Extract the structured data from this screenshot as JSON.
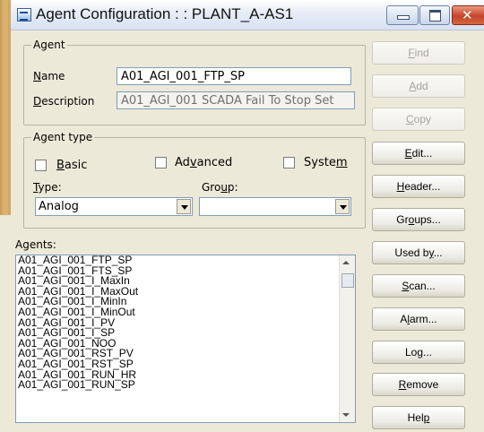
{
  "window": {
    "title": "Agent Configuration : : PLANT_A-AS1"
  },
  "agent_group": {
    "label": "Agent",
    "name_label": "Name",
    "name_value": "A01_AGI_001_FTP_SP",
    "description_label": "Description",
    "description_value": "A01_AGI_001  SCADA Fail To Stop Set"
  },
  "agent_type_group": {
    "label": "Agent type",
    "basic_label": "Basic",
    "advanced_label": "Advanced",
    "system_label": "System",
    "basic_checked": false,
    "advanced_checked": false,
    "system_checked": false,
    "type_label": "Type:",
    "type_value": "Analog",
    "group_label": "Group:",
    "group_value": ""
  },
  "agents_list": {
    "label": "Agents:",
    "items": [
      "A01_AGI_001_FTP_SP",
      "A01_AGI_001_FTS_SP",
      "A01_AGI_001_I_MaxIn",
      "A01_AGI_001_I_MaxOut",
      "A01_AGI_001_I_MinIn",
      "A01_AGI_001_I_MinOut",
      "A01_AGI_001_I_PV",
      "A01_AGI_001_I_SP",
      "A01_AGI_001_NOO",
      "A01_AGI_001_RST_PV",
      "A01_AGI_001_RST_SP",
      "A01_AGI_001_RUN_HR",
      "A01_AGI_001_RUN_SP"
    ]
  },
  "buttons": {
    "find": "Find",
    "add": "Add",
    "copy": "Copy",
    "edit": "Edit...",
    "header": "Header...",
    "groups": "Groups...",
    "used_by": "Used by...",
    "scan": "Scan...",
    "alarm": "Alarm...",
    "log": "Log...",
    "remove": "Remove",
    "help": "Help"
  },
  "colors": {
    "dialog_bg": "#ece9d8",
    "close_button": "#c5442a",
    "disabled_text": "#a5a49c"
  }
}
